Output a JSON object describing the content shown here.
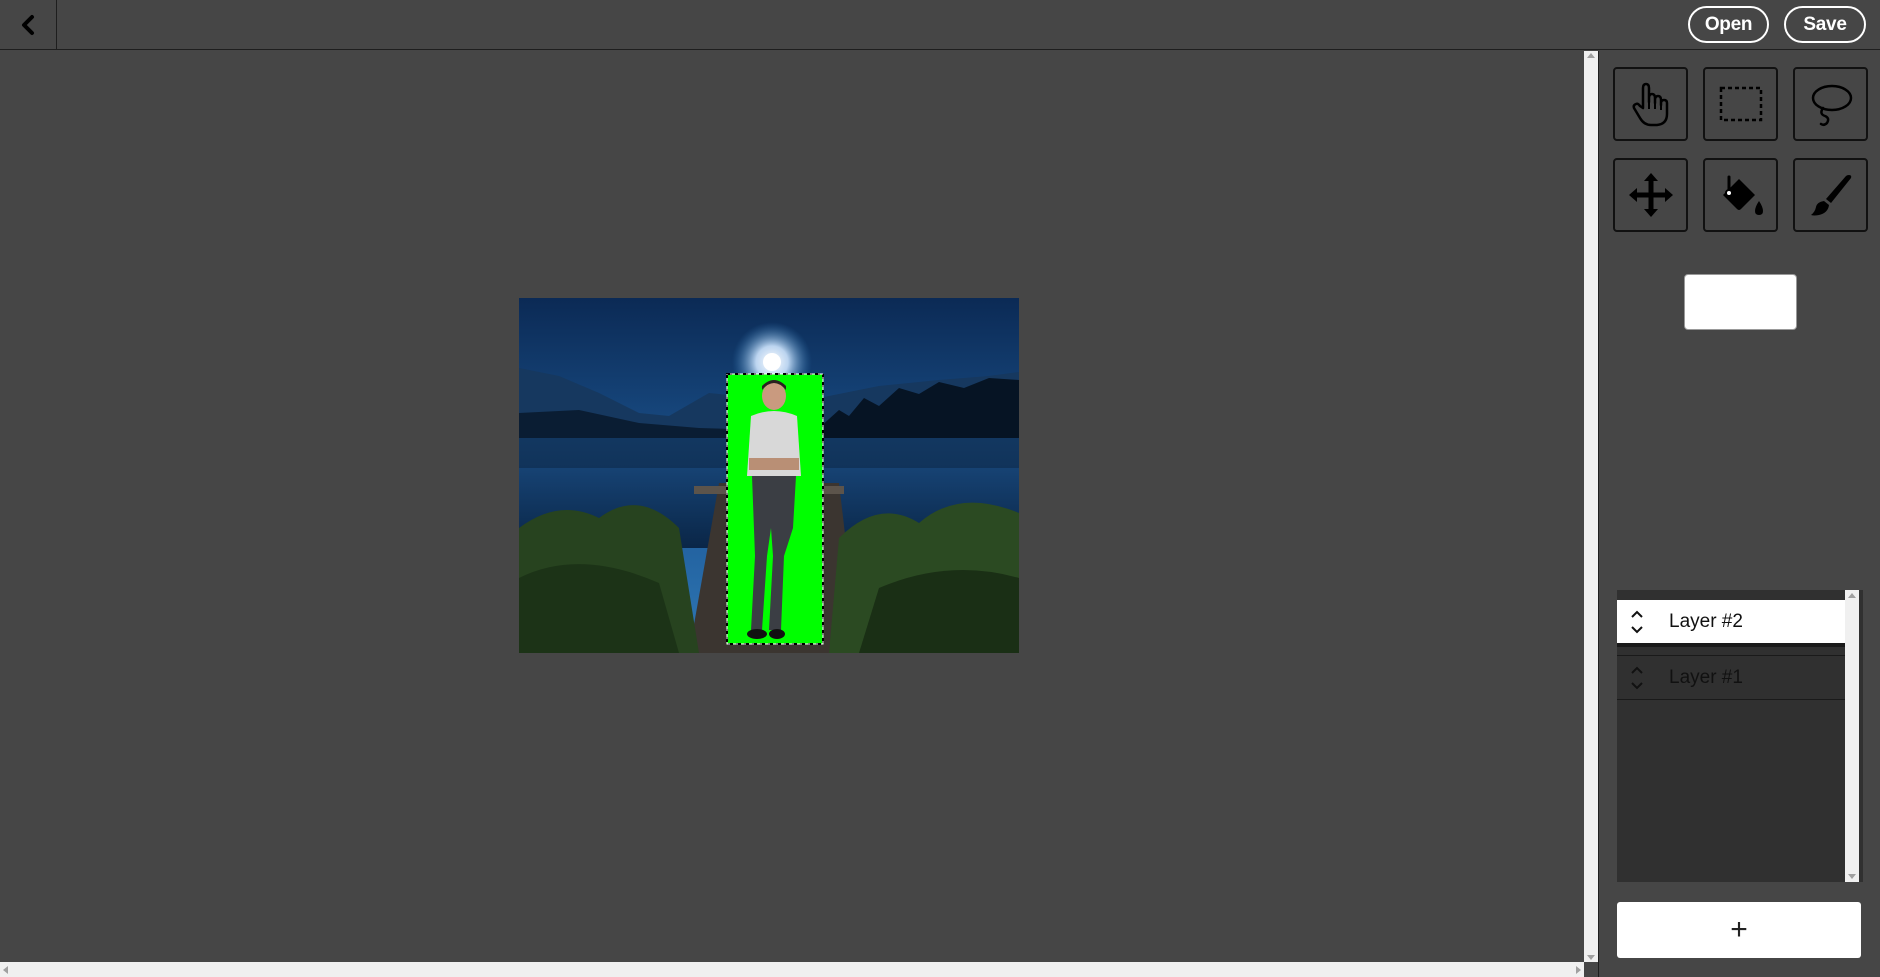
{
  "topbar": {
    "back_icon": "chevron-left-icon",
    "open_label": "Open",
    "save_label": "Save"
  },
  "tools": [
    {
      "name": "hand-tool",
      "icon": "hand-icon"
    },
    {
      "name": "rect-select-tool",
      "icon": "rect-select-icon"
    },
    {
      "name": "lasso-tool",
      "icon": "lasso-icon"
    },
    {
      "name": "move-tool",
      "icon": "move-icon"
    },
    {
      "name": "fill-tool",
      "icon": "paint-bucket-icon"
    },
    {
      "name": "brush-tool",
      "icon": "brush-icon"
    }
  ],
  "color": {
    "current": "#ffffff"
  },
  "layers": [
    {
      "label": "Layer #2",
      "active": true
    },
    {
      "label": "Layer #1",
      "active": false
    }
  ],
  "add_layer_label": "+",
  "colors": {
    "background": "#464646",
    "selection_fill": "#00ff00",
    "panel_dark": "#303030"
  }
}
